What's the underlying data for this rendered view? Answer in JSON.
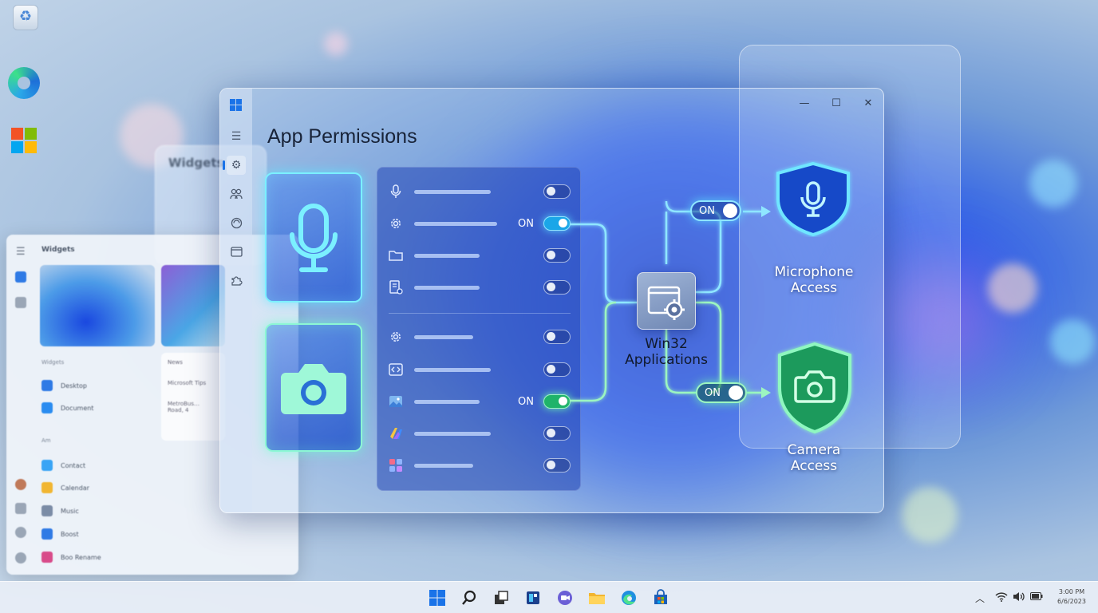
{
  "desktop": {
    "icons": [
      "recycle-bin-icon",
      "edge-icon",
      "microsoft-store-icon"
    ],
    "background_widget_title": "Widgets"
  },
  "start_panel": {
    "title": "Widgets",
    "news_label": "News",
    "news_sub": "Microsoft Tips",
    "news_item": "MetroBus…",
    "news_item_sub": "Road, 4",
    "section_widgets": "Widgets",
    "section_apps": "Am",
    "items": [
      {
        "label": "Desktop",
        "color": "#2f7ae5"
      },
      {
        "label": "Document",
        "color": "#2a8cf0"
      },
      {
        "label": "Contact",
        "color": "#38a4f5"
      },
      {
        "label": "Calendar",
        "color": "#f1b632"
      },
      {
        "label": "Music",
        "color": "#7b8ca6"
      },
      {
        "label": "Boost",
        "color": "#2f7ae5"
      },
      {
        "label": "Boo Rename",
        "color": "#d84b8a"
      }
    ]
  },
  "window": {
    "title": "App Permissions",
    "controls": {
      "minimize": "—",
      "maximize": "☐",
      "close": "✕"
    },
    "nav": [
      "menu-icon",
      "settings-icon",
      "people-icon",
      "privacy-icon",
      "window-icon",
      "puzzle-icon"
    ]
  },
  "categories": [
    {
      "name": "microphone",
      "icon": "microphone-icon"
    },
    {
      "name": "camera",
      "icon": "camera-icon"
    }
  ],
  "permission_list": {
    "group1": [
      {
        "icon": "microphone-icon",
        "on": false,
        "label": ""
      },
      {
        "icon": "gear-icon",
        "on": true,
        "label": "ON"
      },
      {
        "icon": "folder-icon",
        "on": false,
        "label": ""
      },
      {
        "icon": "document-settings-icon",
        "on": false,
        "label": ""
      }
    ],
    "group2": [
      {
        "icon": "gear-icon",
        "on": false,
        "label": ""
      },
      {
        "icon": "code-icon",
        "on": false,
        "label": ""
      },
      {
        "icon": "photos-icon",
        "on": true,
        "label": "ON"
      },
      {
        "icon": "visual-studio-icon",
        "on": false,
        "label": ""
      },
      {
        "icon": "app-grid-icon",
        "on": false,
        "label": ""
      }
    ]
  },
  "flow": {
    "hub_line1": "Win32",
    "hub_line2": "Applications",
    "toggle_mic": "ON",
    "toggle_cam": "ON",
    "mic_line1": "Microphone",
    "mic_line2": "Access",
    "cam_line1": "Camera",
    "cam_line2": "Access",
    "colors": {
      "mic": "#5fe3ff",
      "cam": "#7ff5b8"
    }
  },
  "taskbar": {
    "apps": [
      "start-icon",
      "search-icon",
      "task-view-icon",
      "widgets-icon",
      "chat-icon",
      "file-explorer-icon",
      "edge-icon",
      "store-icon"
    ],
    "tray": [
      "chevron-up-icon",
      "wifi-icon",
      "volume-icon",
      "battery-icon"
    ],
    "time": "3:00 PM",
    "date": "6/6/2023"
  }
}
